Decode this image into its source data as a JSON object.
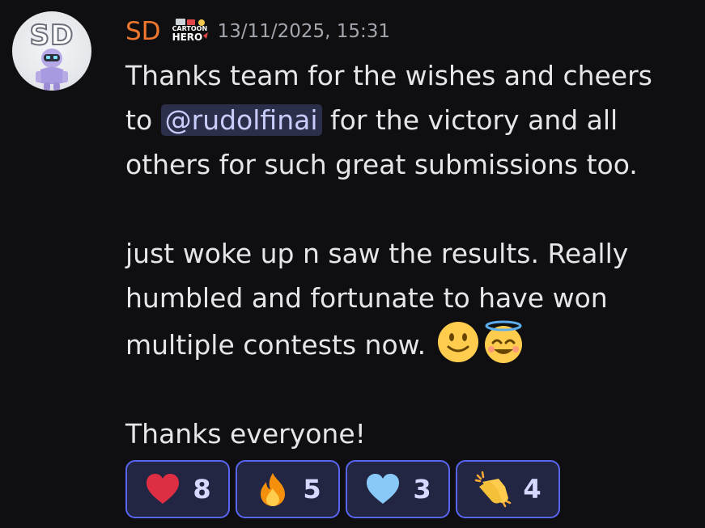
{
  "message": {
    "avatar_initials": "SD",
    "username": "SD",
    "badge": {
      "line1": "CARTOON",
      "line2": "HERO"
    },
    "timestamp": "13/11/2025, 15:31",
    "lines": {
      "l1": "Thanks team for the wishes and cheers",
      "l2_before": "to ",
      "mention": "@rudolfinai",
      "l2_after": " for the victory and all",
      "l3": "others for such great submissions too.",
      "l4": "just woke up n saw the results. Really",
      "l5": "humbled and fortunate to have won",
      "l6": "multiple contests now. ",
      "l7": "Thanks everyone!"
    },
    "inline_emojis": [
      "slightly-smiling-face",
      "smiling-face-with-halo"
    ]
  },
  "reactions": [
    {
      "emoji": "red-heart",
      "count": "8"
    },
    {
      "emoji": "fire",
      "count": "5"
    },
    {
      "emoji": "light-blue-heart",
      "count": "3"
    },
    {
      "emoji": "clapping-hands",
      "count": "4"
    }
  ],
  "colors": {
    "background": "#0f0f12",
    "username": "#f0772d",
    "mention_bg": "#2c2f4a",
    "mention_text": "#c9cdfb",
    "reaction_border": "#5865f2",
    "reaction_bg": "#232643"
  }
}
